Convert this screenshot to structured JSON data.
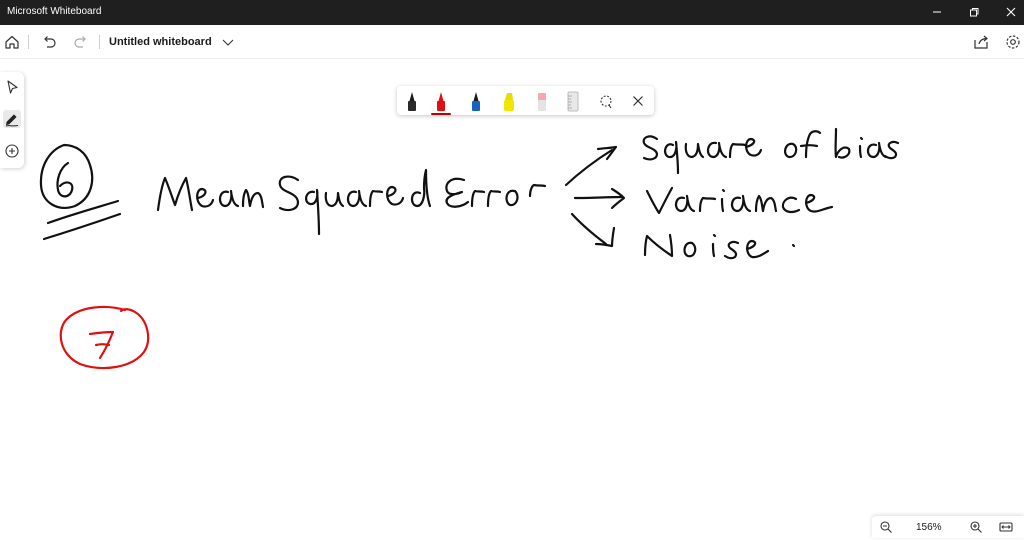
{
  "window": {
    "title": "Microsoft Whiteboard",
    "controls": [
      "minimize",
      "restore",
      "close"
    ]
  },
  "appbar": {
    "board_name": "Untitled whiteboard",
    "left_icons": [
      "home-icon",
      "undo-icon",
      "redo-icon"
    ],
    "right_icons": [
      "share-icon",
      "settings-icon"
    ]
  },
  "left_toolbar": {
    "tools": [
      {
        "name": "select-tool",
        "active": false
      },
      {
        "name": "pen-tool",
        "active": true
      },
      {
        "name": "add-tool",
        "active": false
      }
    ]
  },
  "ink_toolbar": {
    "pens": [
      {
        "name": "black-pen",
        "color": "#1a1a1a",
        "selected": false
      },
      {
        "name": "red-pen",
        "color": "#e01010",
        "selected": true
      },
      {
        "name": "blue-pen",
        "color": "#1565c0",
        "selected": false
      },
      {
        "name": "yellow-highlighter",
        "color": "#f2e600",
        "selected": false
      },
      {
        "name": "eraser",
        "color": "#f4a9b0",
        "selected": false
      },
      {
        "name": "ruler",
        "color": "#bdbdbd",
        "selected": false
      }
    ],
    "extras": [
      "lasso-icon",
      "close-icon"
    ]
  },
  "canvas": {
    "ink_colors": {
      "black": "#111111",
      "red": "#e01010"
    },
    "strokes": [
      {
        "name": "number-6-circle",
        "color": "black"
      },
      {
        "name": "text-mean-squared-error",
        "color": "black"
      },
      {
        "name": "arrow-square-of-bias",
        "color": "black"
      },
      {
        "name": "text-square-of-bias",
        "color": "black"
      },
      {
        "name": "arrow-variance",
        "color": "black"
      },
      {
        "name": "text-variance",
        "color": "black"
      },
      {
        "name": "arrow-noise",
        "color": "black"
      },
      {
        "name": "text-noise",
        "color": "black"
      },
      {
        "name": "number-7-circle",
        "color": "red"
      }
    ]
  },
  "zoom": {
    "level": "156%"
  }
}
